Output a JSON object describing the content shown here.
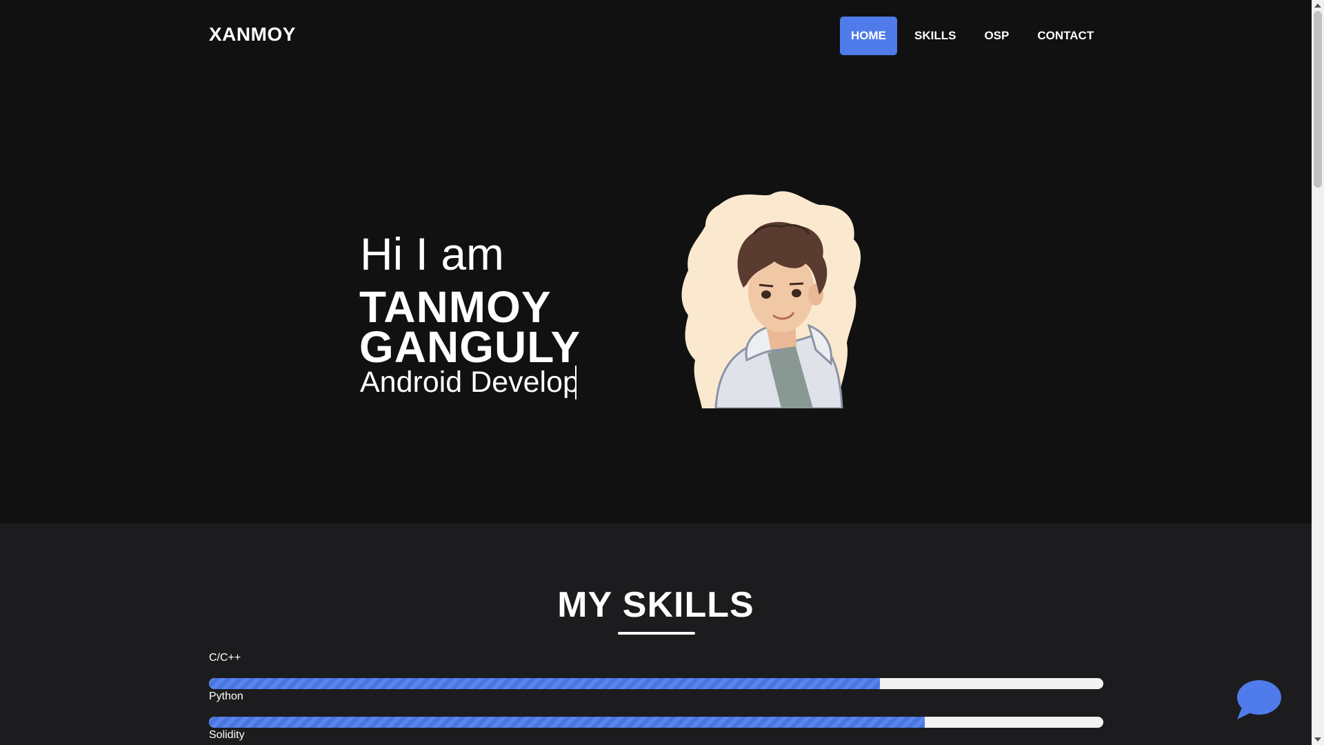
{
  "nav": {
    "brand": "XANMOY",
    "items": [
      {
        "label": "HOME",
        "active": true
      },
      {
        "label": "SKILLS",
        "active": false
      },
      {
        "label": "OSP",
        "active": false
      },
      {
        "label": "CONTACT",
        "active": false
      }
    ]
  },
  "hero": {
    "greeting": "Hi I am",
    "name_line1": "TANMOY",
    "name_line2": "GANGULY",
    "role": "Android Develop",
    "avatar_icon": "cartoon-avatar"
  },
  "skills": {
    "title": "MY SKILLS",
    "items": [
      {
        "label": "C/C++",
        "percent": 75
      },
      {
        "label": "Python",
        "percent": 80
      },
      {
        "label": "Solidity",
        "percent": null
      }
    ]
  },
  "colors": {
    "accent": "#4f7cea",
    "background": "#111111",
    "skills_background": "#1c1c1e"
  },
  "chat": {
    "icon": "chat-bubble-icon"
  }
}
